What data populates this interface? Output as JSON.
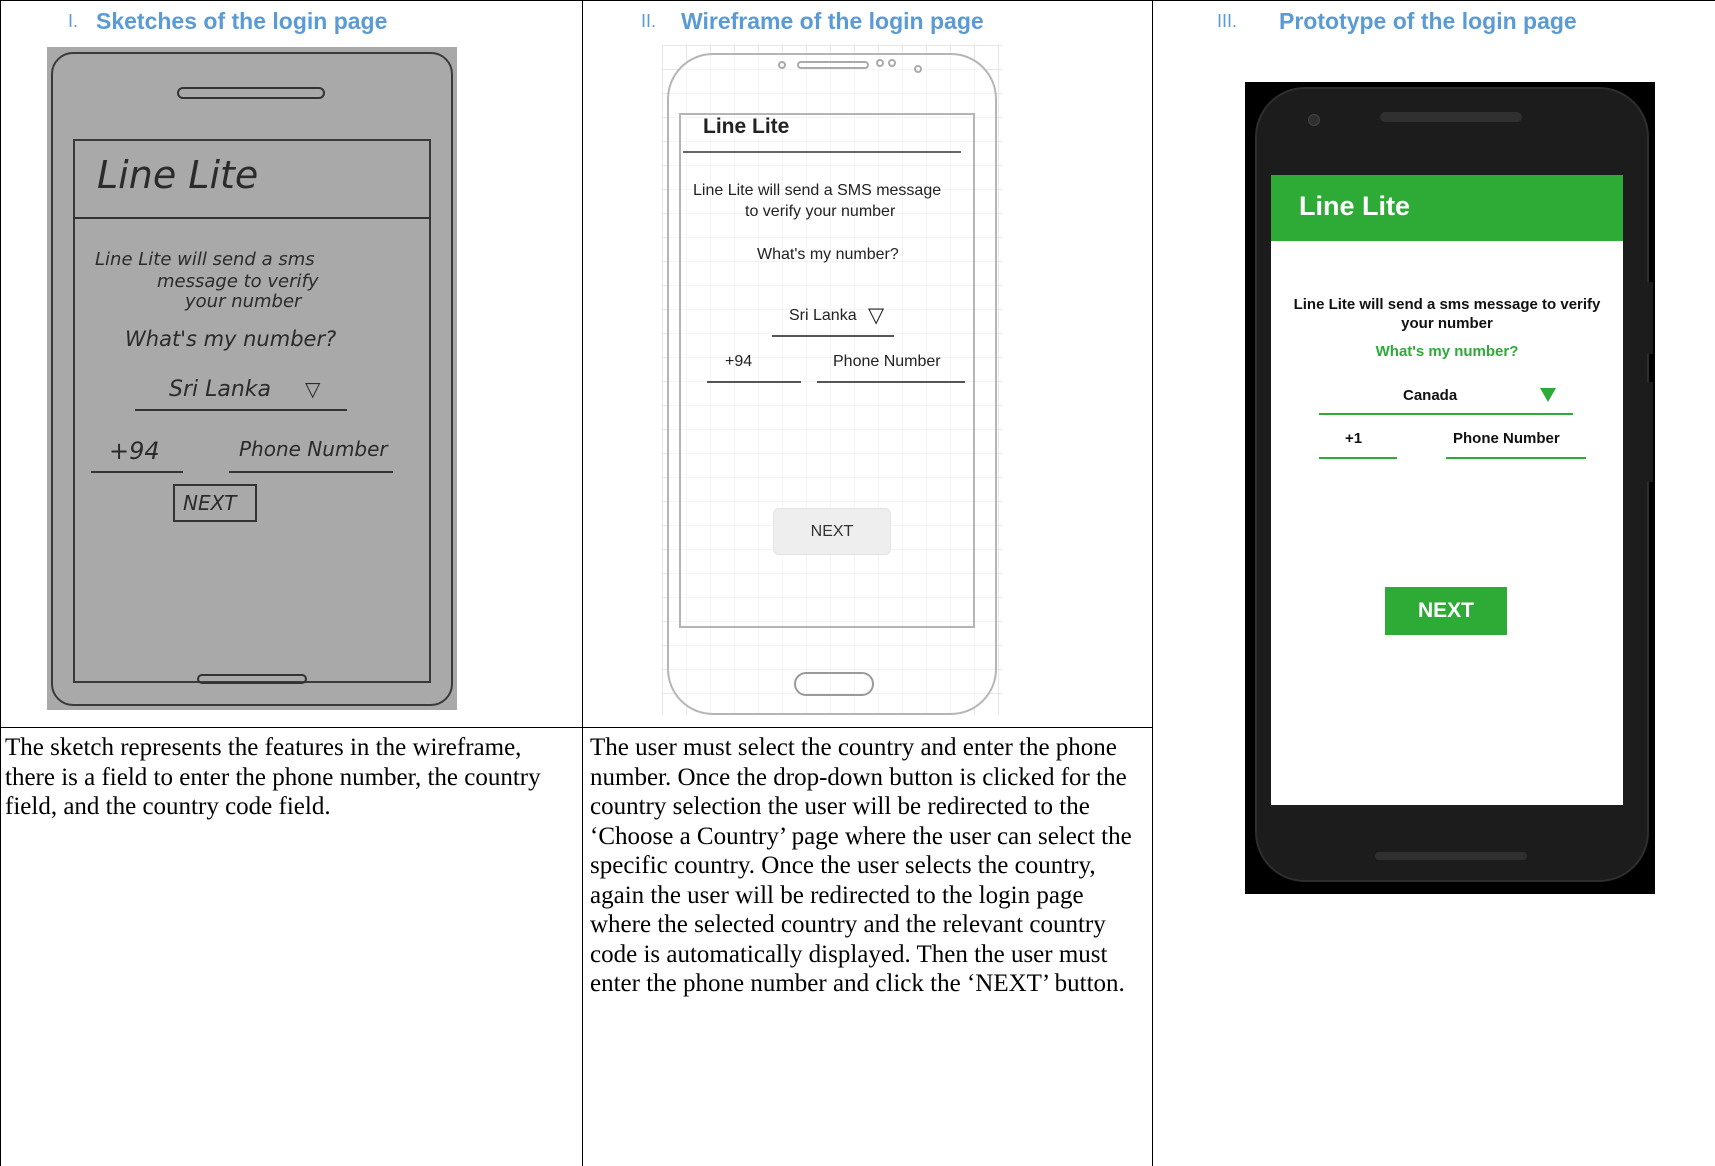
{
  "columns": [
    {
      "num": "I.",
      "title": "Sketches of the login page"
    },
    {
      "num": "II.",
      "title": "Wireframe of the login page"
    },
    {
      "num": "III.",
      "title": "Prototype of the login page"
    }
  ],
  "descriptions": {
    "sketch": "The sketch represents the features in the wireframe, there is a field to enter the phone number, the country field, and the country code field.",
    "wireframe": "The user must select the country and enter the phone number. Once the drop-down button is clicked for the country selection the user will be redirected to the ‘Choose a Country’ page where the user can select the specific country. Once the user selects the country, again the user will be redirected to the login page where the selected country and the relevant country code is automatically displayed. Then the user must enter the phone number and click the ‘NEXT’ button."
  },
  "sketch": {
    "title": "Line Lite",
    "message_line1": "Line Lite will send a sms",
    "message_line2": "message to verify",
    "message_line3": "your number",
    "question": "What's my number?",
    "country": "Sri Lanka",
    "dropdown_glyph": "▽",
    "code": "+94",
    "phone_label": "Phone Number",
    "next": "NEXT"
  },
  "wireframe": {
    "title": "Line Lite",
    "message_line1": "Line Lite will send a SMS message",
    "message_line2": "to verify your number",
    "question": "What's my number?",
    "country": "Sri Lanka",
    "dropdown_glyph": "▽",
    "code": "+94",
    "phone_label": "Phone Number",
    "next": "NEXT"
  },
  "prototype": {
    "title": "Line Lite",
    "message_line1": "Line Lite will send a sms message to verify",
    "message_line2": "your number",
    "question": "What's my number?",
    "country": "Canada",
    "code": "+1",
    "phone_label": "Phone Number",
    "next": "NEXT",
    "accent_color": "#2eaa36"
  },
  "colors": {
    "header_text": "#5b9bd5"
  }
}
